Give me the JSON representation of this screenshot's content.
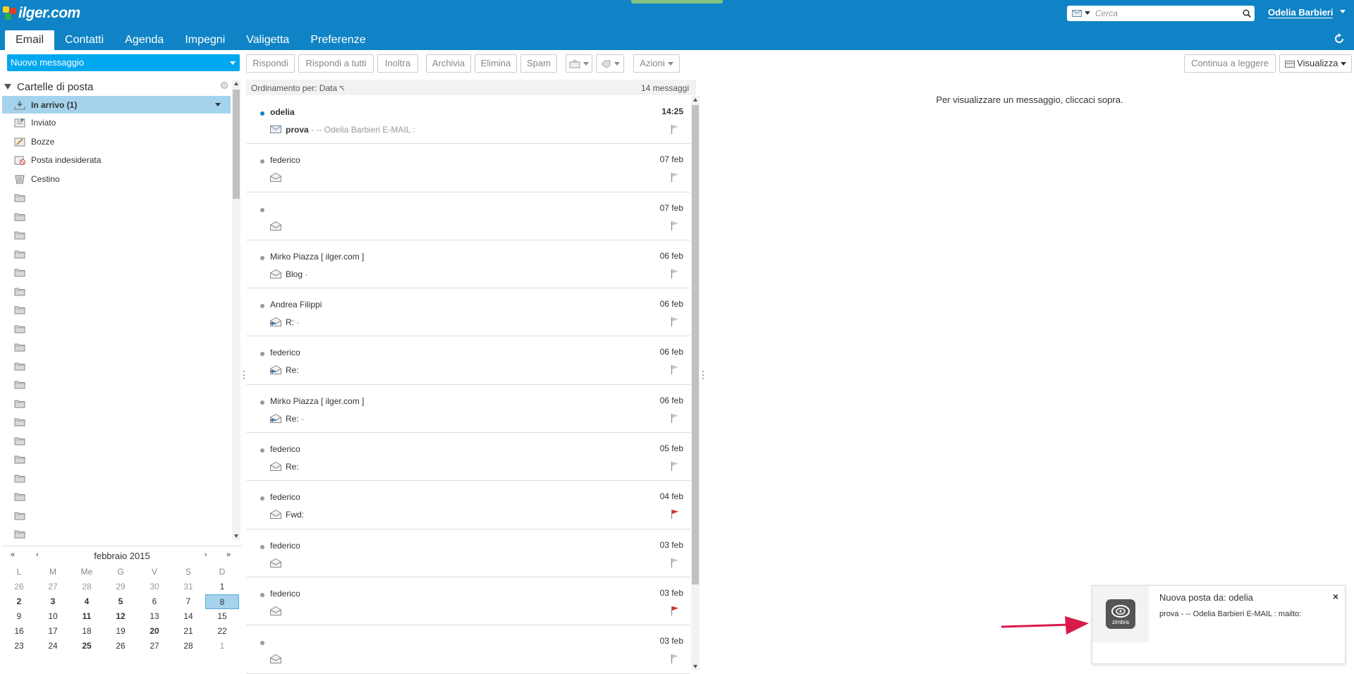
{
  "header": {
    "logo_text": "ilger.com",
    "search_placeholder": "Cerca",
    "user_name": "Odelia Barbieri",
    "tabs": [
      "Email",
      "Contatti",
      "Agenda",
      "Impegni",
      "Valigetta",
      "Preferenze"
    ],
    "active_tab": "Email"
  },
  "toolbar": {
    "new_message": "Nuovo messaggio",
    "reply": "Rispondi",
    "reply_all": "Rispondi a tutti",
    "forward": "Inoltra",
    "archive": "Archivia",
    "delete": "Elimina",
    "spam": "Spam",
    "actions": "Azioni",
    "continue_reading": "Continua a leggere",
    "view": "Visualizza"
  },
  "folders": {
    "header": "Cartelle di posta",
    "items": [
      {
        "label": "In arrivo (1)",
        "icon": "inbox-icon",
        "selected": true
      },
      {
        "label": "Inviato",
        "icon": "sent-icon"
      },
      {
        "label": "Bozze",
        "icon": "drafts-icon"
      },
      {
        "label": "Posta indesiderata",
        "icon": "junk-icon"
      },
      {
        "label": "Cestino",
        "icon": "trash-icon"
      }
    ],
    "empty_folder_count": 19
  },
  "calendar": {
    "title": "febbraio 2015",
    "nav": {
      "prev_year": "«",
      "prev_month": "‹",
      "next_month": "›",
      "next_year": "»"
    },
    "dow": [
      "L",
      "M",
      "Me",
      "G",
      "V",
      "S",
      "D"
    ],
    "weeks": [
      [
        {
          "d": "26",
          "o": 1
        },
        {
          "d": "27",
          "o": 1
        },
        {
          "d": "28",
          "o": 1
        },
        {
          "d": "29",
          "o": 1
        },
        {
          "d": "30",
          "o": 1
        },
        {
          "d": "31",
          "o": 1
        },
        {
          "d": "1"
        }
      ],
      [
        {
          "d": "2",
          "b": 1
        },
        {
          "d": "3",
          "b": 1
        },
        {
          "d": "4",
          "b": 1
        },
        {
          "d": "5",
          "b": 1
        },
        {
          "d": "6"
        },
        {
          "d": "7"
        },
        {
          "d": "8",
          "t": 1
        }
      ],
      [
        {
          "d": "9"
        },
        {
          "d": "10"
        },
        {
          "d": "11",
          "b": 1
        },
        {
          "d": "12",
          "b": 1
        },
        {
          "d": "13"
        },
        {
          "d": "14"
        },
        {
          "d": "15"
        }
      ],
      [
        {
          "d": "16"
        },
        {
          "d": "17"
        },
        {
          "d": "18"
        },
        {
          "d": "19"
        },
        {
          "d": "20",
          "b": 1
        },
        {
          "d": "21"
        },
        {
          "d": "22"
        }
      ],
      [
        {
          "d": "23"
        },
        {
          "d": "24"
        },
        {
          "d": "25",
          "b": 1
        },
        {
          "d": "26"
        },
        {
          "d": "27"
        },
        {
          "d": "28"
        },
        {
          "d": "1",
          "o": 1
        }
      ]
    ]
  },
  "list": {
    "sort_label": "Ordinamento per: Data",
    "count": "14 messaggi",
    "messages": [
      {
        "from": "odelia",
        "date": "14:25",
        "subject": "prova",
        "fragment": " - -- Odelia Barbieri E-MAIL :",
        "unread": true,
        "flag": "grey",
        "icon": "envelope-closed"
      },
      {
        "from": "federico",
        "date": "07 feb",
        "subject": "",
        "fragment": "",
        "flag": "grey",
        "icon": "envelope-open"
      },
      {
        "from": "",
        "date": "07 feb",
        "subject": "",
        "fragment": "",
        "flag": "grey",
        "icon": "envelope-open"
      },
      {
        "from": "Mirko Piazza [ ilger.com ]",
        "date": "06 feb",
        "subject": "Blog",
        "fragment": " -",
        "flag": "grey",
        "icon": "envelope-open"
      },
      {
        "from": "Andrea Filippi",
        "date": "06 feb",
        "subject": "R:",
        "fragment": " -",
        "flag": "grey",
        "icon": "envelope-replied"
      },
      {
        "from": "federico",
        "date": "06 feb",
        "subject": "Re:",
        "fragment": "",
        "flag": "grey",
        "icon": "envelope-replied"
      },
      {
        "from": "Mirko Piazza [ ilger.com ]",
        "date": "06 feb",
        "subject": "Re:",
        "fragment": " -",
        "flag": "grey",
        "icon": "envelope-replied"
      },
      {
        "from": "federico",
        "date": "05 feb",
        "subject": "Re:",
        "fragment": "",
        "flag": "grey",
        "icon": "envelope-open"
      },
      {
        "from": "federico",
        "date": "04 feb",
        "subject": "Fwd:",
        "fragment": "",
        "flag": "red",
        "icon": "envelope-open"
      },
      {
        "from": "federico",
        "date": "03 feb",
        "subject": "",
        "fragment": "",
        "flag": "grey",
        "icon": "envelope-open"
      },
      {
        "from": "federico",
        "date": "03 feb",
        "subject": "",
        "fragment": "",
        "flag": "red",
        "icon": "envelope-open"
      },
      {
        "from": "",
        "date": "03 feb",
        "subject": "",
        "fragment": "",
        "flag": "grey",
        "icon": "envelope-open"
      }
    ]
  },
  "reader": {
    "empty_message": "Per visualizzare un messaggio, cliccaci sopra."
  },
  "toast": {
    "title": "Nuova posta da: odelia",
    "body": "prova - -- Odelia Barbieri E-MAIL : mailto:",
    "logo_text": "zimbra",
    "close": "×"
  },
  "colors": {
    "brand": "#0f83c5",
    "new_message": "#00a8f0",
    "selected": "#a5d3ee",
    "flag_red": "#d03030",
    "arrow": "#d81b4a"
  }
}
